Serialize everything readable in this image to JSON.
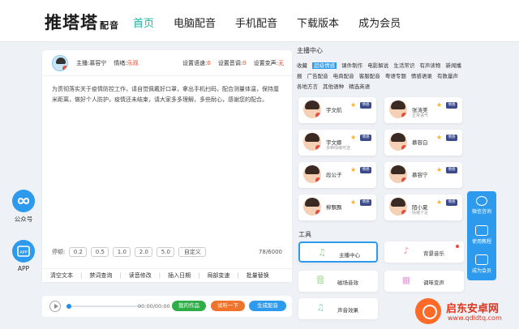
{
  "header": {
    "logo_main": "推塔塔",
    "logo_sub": "配音",
    "nav": [
      "首页",
      "电脑配音",
      "手机配音",
      "下载版本",
      "成为会员"
    ],
    "nav_active": 0
  },
  "editor": {
    "anchor_label": "主播:慕容宁",
    "emotion_label": "情绪:",
    "emotion_value": "乐观",
    "speed_label": "设置语速:",
    "speed_value": "0",
    "volume_label": "设置音调:",
    "volume_value": "0",
    "pitch_label": "设置变声:",
    "pitch_value": "无",
    "text": "为贯彻落实关于疫情防控工作，请自觉佩戴好口罩，拿出手机扫码，配合测量体温，保持厘米距离，做好个人防护，疫情还未结束，请大家多多理解，多些耐心，感谢您的配合。",
    "pause_label": "停顿:",
    "pauses": [
      "0.2",
      "0.5",
      "1.0",
      "2.0",
      "5.0",
      "自定义"
    ],
    "char_count": "78/6000"
  },
  "toolbar": [
    "清空文本",
    "禁词查询",
    "读音修改",
    "插入日期",
    "局部变速",
    "批量替换"
  ],
  "player": {
    "time": "00:00/00:00",
    "btn_works": "我的作品",
    "btn_try": "试听一下",
    "btn_generate": "生成配音"
  },
  "side_left": {
    "wechat": "公众号",
    "app": "APP"
  },
  "anchor_panel": {
    "title": "主播中心",
    "tags": [
      "收藏",
      "超级情感",
      "课件制作",
      "电影解说",
      "生活常识",
      "有声读物",
      "新闻播报",
      "广告配音",
      "电商配音",
      "客服配音",
      "粤语专题",
      "情感语录",
      "有数量声",
      "各地方言",
      "其他语种",
      "精选英语"
    ],
    "selected_tag": 1,
    "anchors": [
      {
        "name": "宇文航",
        "sub": "",
        "badge": "情感"
      },
      {
        "name": "张涛美",
        "sub": "正常语气",
        "badge": "情感"
      },
      {
        "name": "宇文娜",
        "sub": "多种情绪可选",
        "badge": "情感"
      },
      {
        "name": "慕容白",
        "sub": "",
        "badge": "情感"
      },
      {
        "name": "段公子",
        "sub": "",
        "badge": "情感"
      },
      {
        "name": "慕容宁",
        "sub": "",
        "badge": "情感"
      },
      {
        "name": "柳飘飘",
        "sub": "",
        "badge": "情感"
      },
      {
        "name": "陌小夏",
        "sub": "情绪十足",
        "badge": "情感"
      }
    ]
  },
  "tools": {
    "title": "工具",
    "items": [
      "主播中心",
      "背景音乐",
      "磁场音效",
      "调味变声",
      "声音效果",
      ""
    ]
  },
  "float_right": [
    "微信咨询",
    "使用教程",
    "成为会员"
  ],
  "watermark": {
    "name": "启东安卓网",
    "url": "www.qdldtq.com"
  },
  "colors": {
    "accent": "#2e9aee",
    "nav_active": "#19b3a0",
    "red": "#e6492d",
    "green": "#2fae47",
    "orange": "#f0732c"
  }
}
